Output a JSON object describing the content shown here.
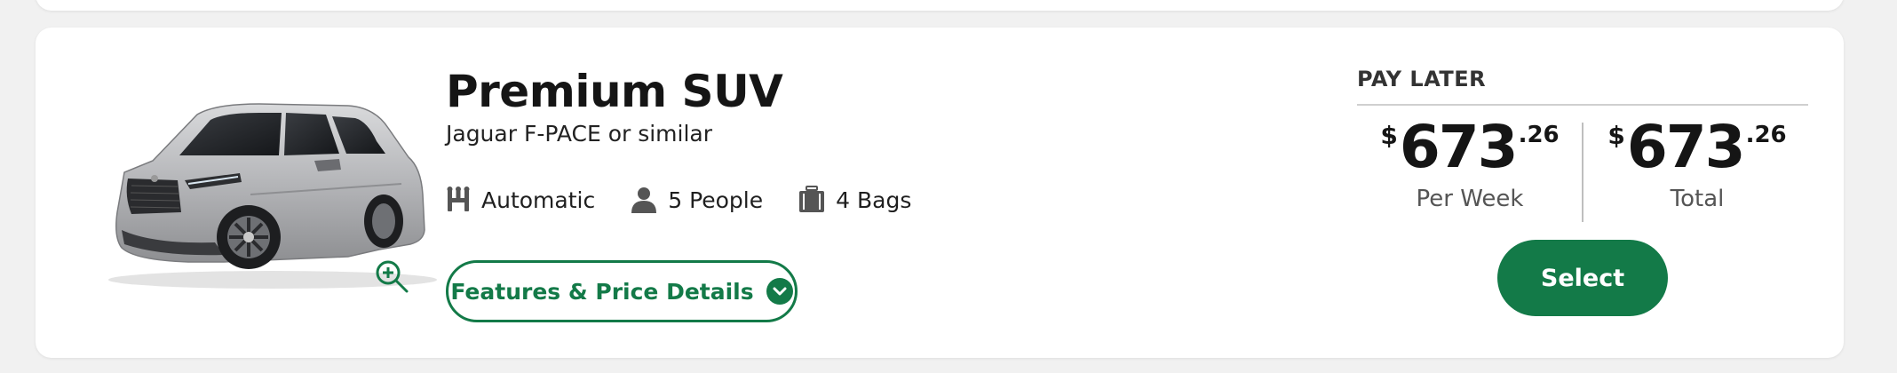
{
  "colors": {
    "brand_green": "#137a48",
    "background": "#f1f1f1",
    "card": "#ffffff"
  },
  "vehicle": {
    "title": "Premium SUV",
    "subtitle": "Jaguar F-PACE or similar",
    "image_icon": "silver-suv-image",
    "zoom_icon": "zoom-in-icon",
    "specs": [
      {
        "icon": "gear-shift-icon",
        "label": "Automatic"
      },
      {
        "icon": "person-icon",
        "label": "5 People"
      },
      {
        "icon": "luggage-icon",
        "label": "4 Bags"
      }
    ],
    "details_button": {
      "label": "Features & Price Details",
      "icon": "chevron-down-icon"
    }
  },
  "pricing": {
    "heading": "PAY LATER",
    "per_week": {
      "currency": "$",
      "amount": "673",
      "cents": ".26",
      "label": "Per Week"
    },
    "total": {
      "currency": "$",
      "amount": "673",
      "cents": ".26",
      "label": "Total"
    },
    "select_label": "Select"
  }
}
